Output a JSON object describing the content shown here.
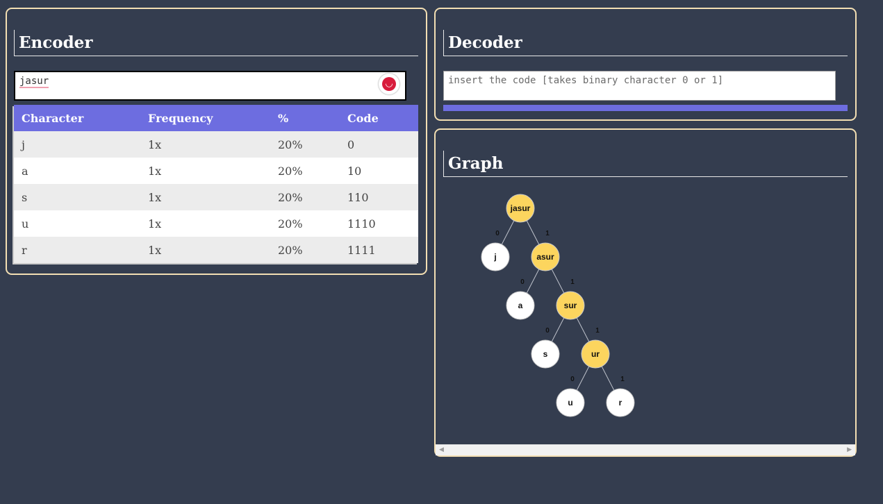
{
  "encoder": {
    "title": "Encoder",
    "input_value": "jasur",
    "table": {
      "headers": [
        "Character",
        "Frequency",
        "%",
        "Code"
      ],
      "rows": [
        [
          "j",
          "1x",
          "20%",
          "0"
        ],
        [
          "a",
          "1x",
          "20%",
          "10"
        ],
        [
          "s",
          "1x",
          "20%",
          "110"
        ],
        [
          "u",
          "1x",
          "20%",
          "1110"
        ],
        [
          "r",
          "1x",
          "20%",
          "1111"
        ]
      ]
    },
    "reset_icon": "refresh-icon"
  },
  "decoder": {
    "title": "Decoder",
    "placeholder": "insert the code [takes binary character 0 or 1]"
  },
  "graph": {
    "title": "Graph",
    "nodes": [
      {
        "label": "jasur",
        "internal": true
      },
      {
        "label": "j",
        "internal": false
      },
      {
        "label": "asur",
        "internal": true
      },
      {
        "label": "a",
        "internal": false
      },
      {
        "label": "sur",
        "internal": true
      },
      {
        "label": "s",
        "internal": false
      },
      {
        "label": "ur",
        "internal": true
      },
      {
        "label": "u",
        "internal": false
      },
      {
        "label": "r",
        "internal": false
      }
    ],
    "edges": [
      {
        "from": 0,
        "to": 1,
        "bit": "0"
      },
      {
        "from": 0,
        "to": 2,
        "bit": "1"
      },
      {
        "from": 2,
        "to": 3,
        "bit": "0"
      },
      {
        "from": 2,
        "to": 4,
        "bit": "1"
      },
      {
        "from": 4,
        "to": 5,
        "bit": "0"
      },
      {
        "from": 4,
        "to": 6,
        "bit": "1"
      },
      {
        "from": 6,
        "to": 7,
        "bit": "0"
      },
      {
        "from": 6,
        "to": 8,
        "bit": "1"
      }
    ]
  },
  "colors": {
    "background": "#343d4f",
    "panel_border": "#f3dfb3",
    "accent": "#6d6de0",
    "internal_node": "#fcd55e",
    "leaf_node": "#ffffff"
  }
}
